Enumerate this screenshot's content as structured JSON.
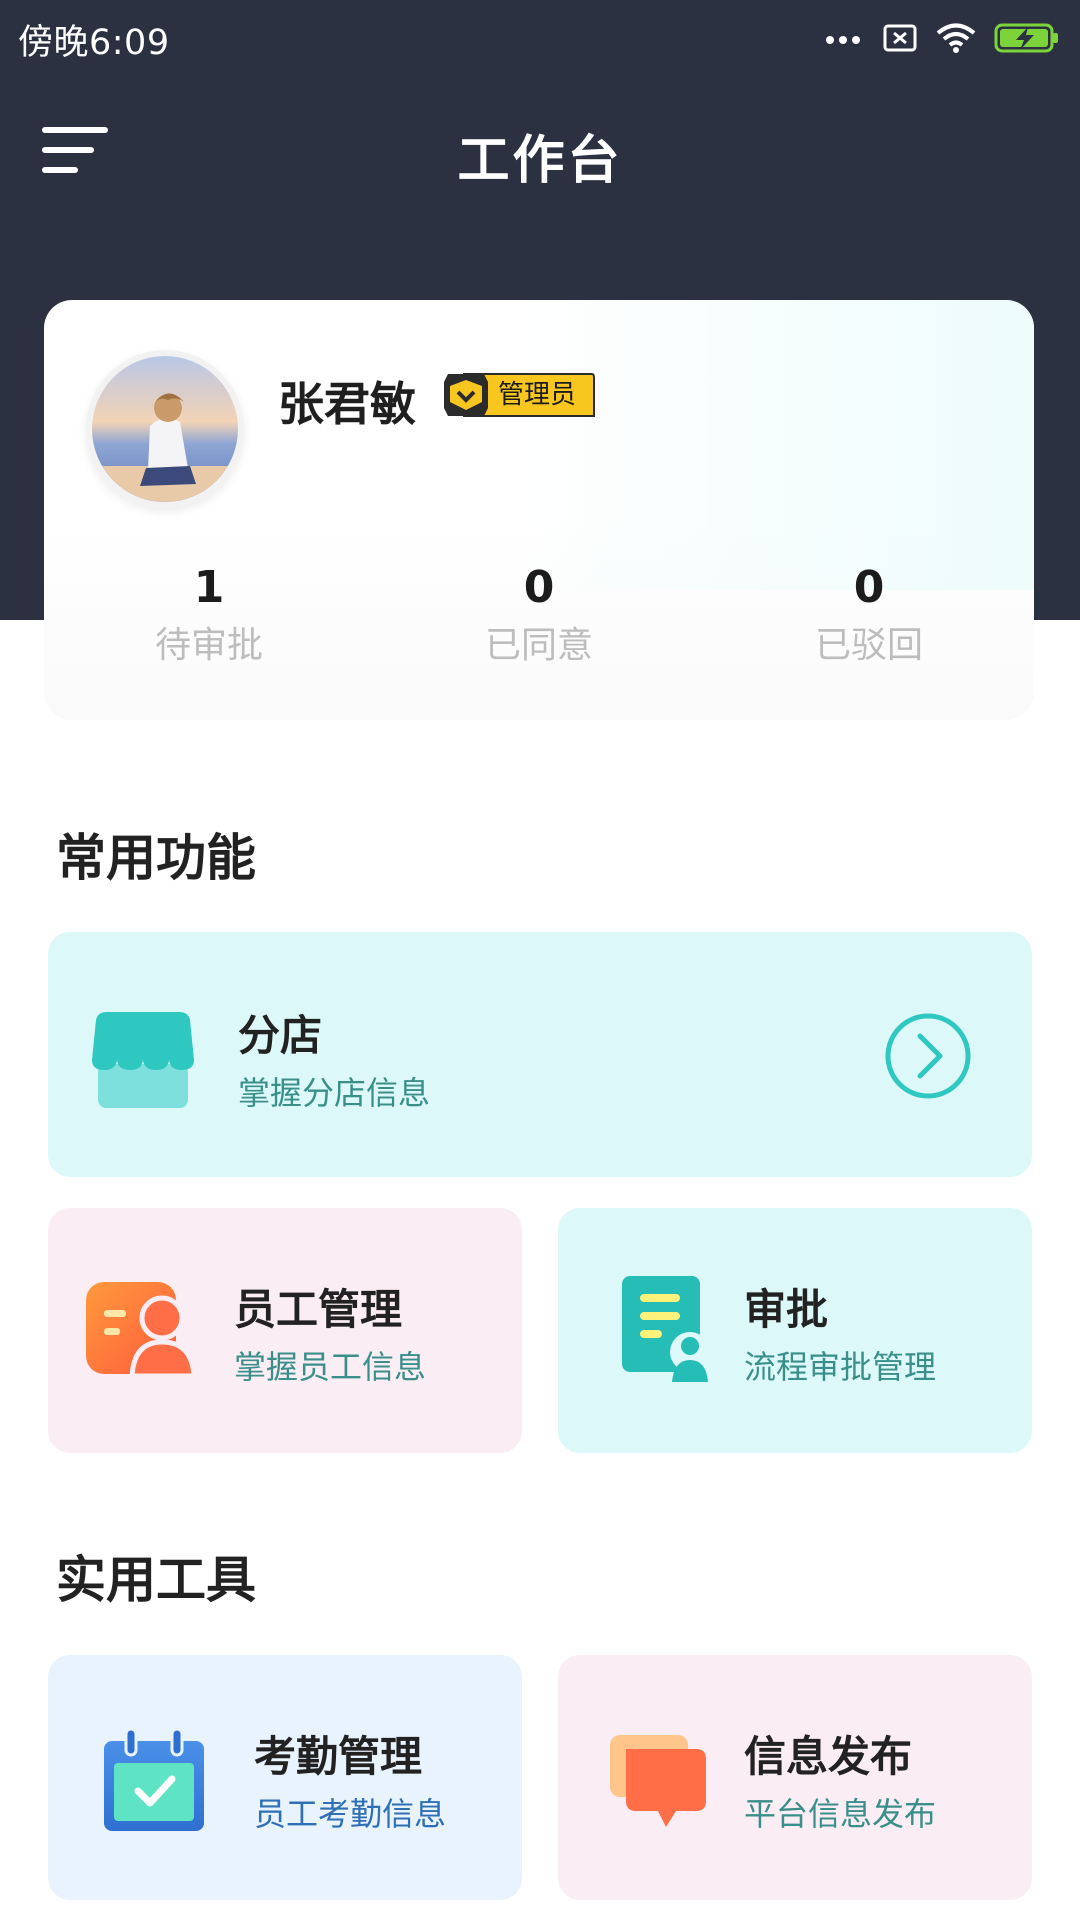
{
  "status_bar": {
    "time": "傍晚6:09"
  },
  "nav": {
    "title": "工作台"
  },
  "profile": {
    "name": "张君敏",
    "role": "管理员",
    "stats": [
      {
        "value": "1",
        "label": "待审批"
      },
      {
        "value": "0",
        "label": "已同意"
      },
      {
        "value": "0",
        "label": "已驳回"
      }
    ]
  },
  "sections": {
    "common_title": "常用功能",
    "tools_title": "实用工具"
  },
  "common": {
    "branch": {
      "title": "分店",
      "subtitle": "掌握分店信息"
    },
    "staff": {
      "title": "员工管理",
      "subtitle": "掌握员工信息"
    },
    "approval": {
      "title": "审批",
      "subtitle": "流程审批管理"
    }
  },
  "tools": {
    "attendance": {
      "title": "考勤管理",
      "subtitle": "员工考勤信息"
    },
    "publish": {
      "title": "信息发布",
      "subtitle": "平台信息发布"
    }
  },
  "colors": {
    "header": "#2c3142",
    "teal": "#2ec8c0",
    "teal_card": "#dcf8f8",
    "pink_card": "#fbedf4",
    "blue_card": "#e9f3fd",
    "badge_yellow": "#f7c720"
  }
}
